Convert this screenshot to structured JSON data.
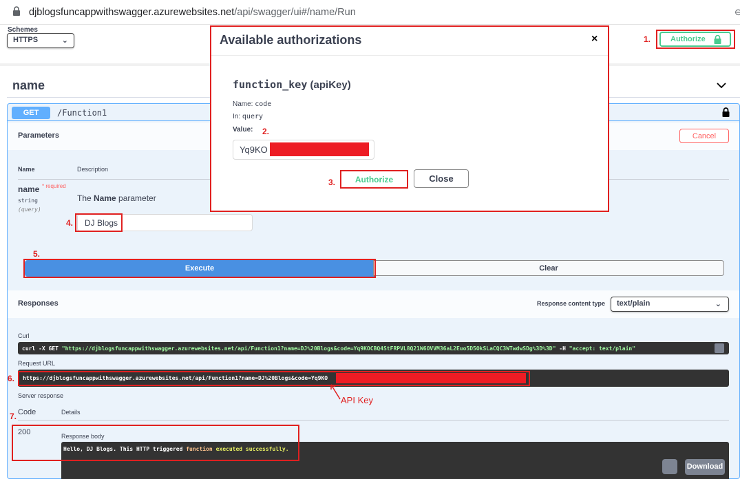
{
  "browser": {
    "url_host": "djblogsfuncappwithswagger.azurewebsites.net",
    "url_path": "/api/swagger/ui#/name/Run"
  },
  "schemes": {
    "label": "Schemes",
    "selected": "HTTPS"
  },
  "top_authorize": {
    "label": "Authorize"
  },
  "tag": {
    "title": "name"
  },
  "operation": {
    "method": "GET",
    "path": "/Function1",
    "parameters_title": "Parameters",
    "cancel_label": "Cancel",
    "col_name": "Name",
    "col_description": "Description",
    "param": {
      "name": "name",
      "required_mark": "* required",
      "type": "string",
      "in": "(query)",
      "desc_pre": "The ",
      "desc_bold": "Name",
      "desc_post": " parameter",
      "value": "DJ Blogs"
    },
    "execute_label": "Execute",
    "clear_label": "Clear"
  },
  "responses": {
    "title": "Responses",
    "content_type_label": "Response content type",
    "content_type": "text/plain",
    "curl_label": "Curl",
    "curl_cmd": "curl -X GET ",
    "curl_url": "\"https://djblogsfuncappwithswagger.azurewebsites.net/api/Function1?name=DJ%20Blogs&code=Yq9KOCBQ4StFRPVL8Q21W6OVVM36aL2Euo5D5OkSLaCQC3WTwdwSDg%3D%3D\"",
    "curl_flag": " -H ",
    "curl_header": "\"accept: text/plain\"",
    "request_url_label": "Request URL",
    "request_url": "https://djblogsfuncappwithswagger.azurewebsites.net/api/Function1?name=DJ%20Blogs&code=Yq9KO",
    "server_response_label": "Server response",
    "code_label": "Code",
    "details_label": "Details",
    "code": "200",
    "response_body_label": "Response body",
    "body_part1": "Hello, DJ Blogs. This HTTP triggered ",
    "body_word_function": "function",
    "body_part2": " executed successfully.",
    "download_label": "Download"
  },
  "modal": {
    "title": "Available authorizations",
    "close_glyph": "×",
    "scheme_name": "function_key",
    "scheme_type": "(apiKey)",
    "name_label": "Name: ",
    "name_value": "code",
    "in_label": "In: ",
    "in_value": "query",
    "value_label": "Value:",
    "key_value": "Yq9KO",
    "authorize_label": "Authorize",
    "close_label": "Close"
  },
  "annotations": {
    "n1": "1.",
    "n2": "2.",
    "n3": "3.",
    "n4": "4.",
    "n5": "5.",
    "n6": "6.",
    "n7": "7.",
    "api_key_label": "API Key"
  },
  "colors": {
    "get": "#61affe",
    "authorize_green": "#49cc90",
    "annotation_red": "#e02020",
    "redaction": "#ed1c24"
  }
}
